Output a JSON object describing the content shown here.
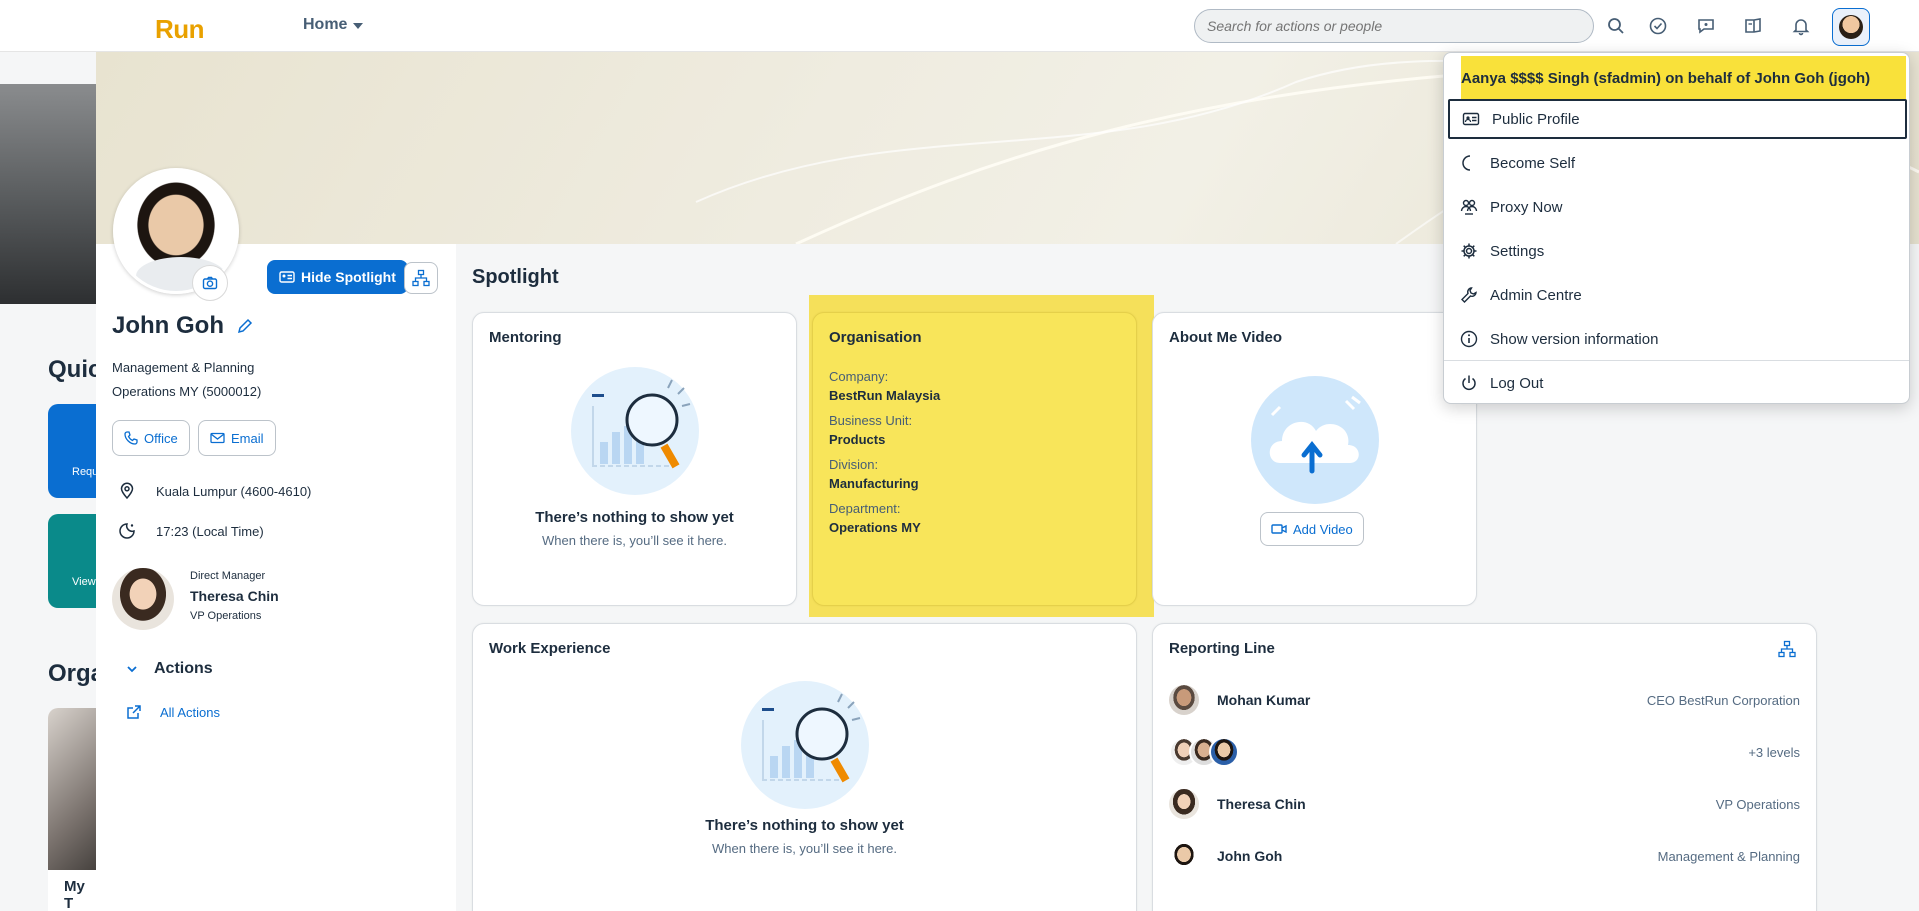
{
  "shell": {
    "logo": "Run",
    "home_label": "Home",
    "search_placeholder": "Search for actions or people"
  },
  "background": {
    "quick_title": "Quic",
    "card1_label": "Requ",
    "card2_label": "View",
    "org_title": "Orga",
    "card3_label": "My T"
  },
  "profile": {
    "hide_spotlight": "Hide Spotlight",
    "name": "John Goh",
    "title_line1": "Management & Planning",
    "title_line2": "Operations MY (5000012)",
    "office_btn": "Office",
    "email_btn": "Email",
    "location": "Kuala Lumpur (4600-4610)",
    "local_time": "17:23 (Local Time)",
    "manager_label": "Direct Manager",
    "manager_name": "Theresa Chin",
    "manager_title": "VP Operations",
    "actions_label": "Actions",
    "all_actions": "All Actions"
  },
  "spotlight": {
    "title": "Spotlight",
    "mentoring": {
      "title": "Mentoring",
      "empty_title": "There’s nothing to show yet",
      "empty_sub": "When there is, you’ll see it here."
    },
    "organisation": {
      "title": "Organisation",
      "company_label": "Company:",
      "company": "BestRun Malaysia",
      "bu_label": "Business Unit:",
      "bu": "Products",
      "division_label": "Division:",
      "division": "Manufacturing",
      "dept_label": "Department:",
      "dept": "Operations MY"
    },
    "about_video": {
      "title": "About Me Video",
      "add_video": "Add Video"
    },
    "work_experience": {
      "title": "Work Experience",
      "empty_title": "There’s nothing to show yet",
      "empty_sub": "When there is, you’ll see it here."
    },
    "reporting_line": {
      "title": "Reporting Line",
      "rows": [
        {
          "name": "Mohan Kumar",
          "title": "CEO BestRun Corporation"
        },
        {
          "name": "",
          "title": "+3 levels"
        },
        {
          "name": "Theresa Chin",
          "title": "VP Operations"
        },
        {
          "name": "John Goh",
          "title": "Management & Planning"
        }
      ]
    }
  },
  "menu": {
    "header": "Aanya $$$$ Singh (sfadmin) on behalf of John Goh (jgoh)",
    "items": [
      {
        "label": "Public Profile",
        "icon": "id-card-icon"
      },
      {
        "label": "Become Self",
        "icon": "moon-icon"
      },
      {
        "label": "Proxy Now",
        "icon": "proxy-icon"
      },
      {
        "label": "Settings",
        "icon": "gear-icon"
      },
      {
        "label": "Admin Centre",
        "icon": "wrench-icon"
      },
      {
        "label": "Show version information",
        "icon": "info-icon"
      },
      {
        "label": "Log Out",
        "icon": "power-icon"
      }
    ]
  },
  "colors": {
    "brand_blue": "#0a6ed1",
    "highlight_yellow": "#f9e13a",
    "logo_orange": "#e9a100"
  }
}
